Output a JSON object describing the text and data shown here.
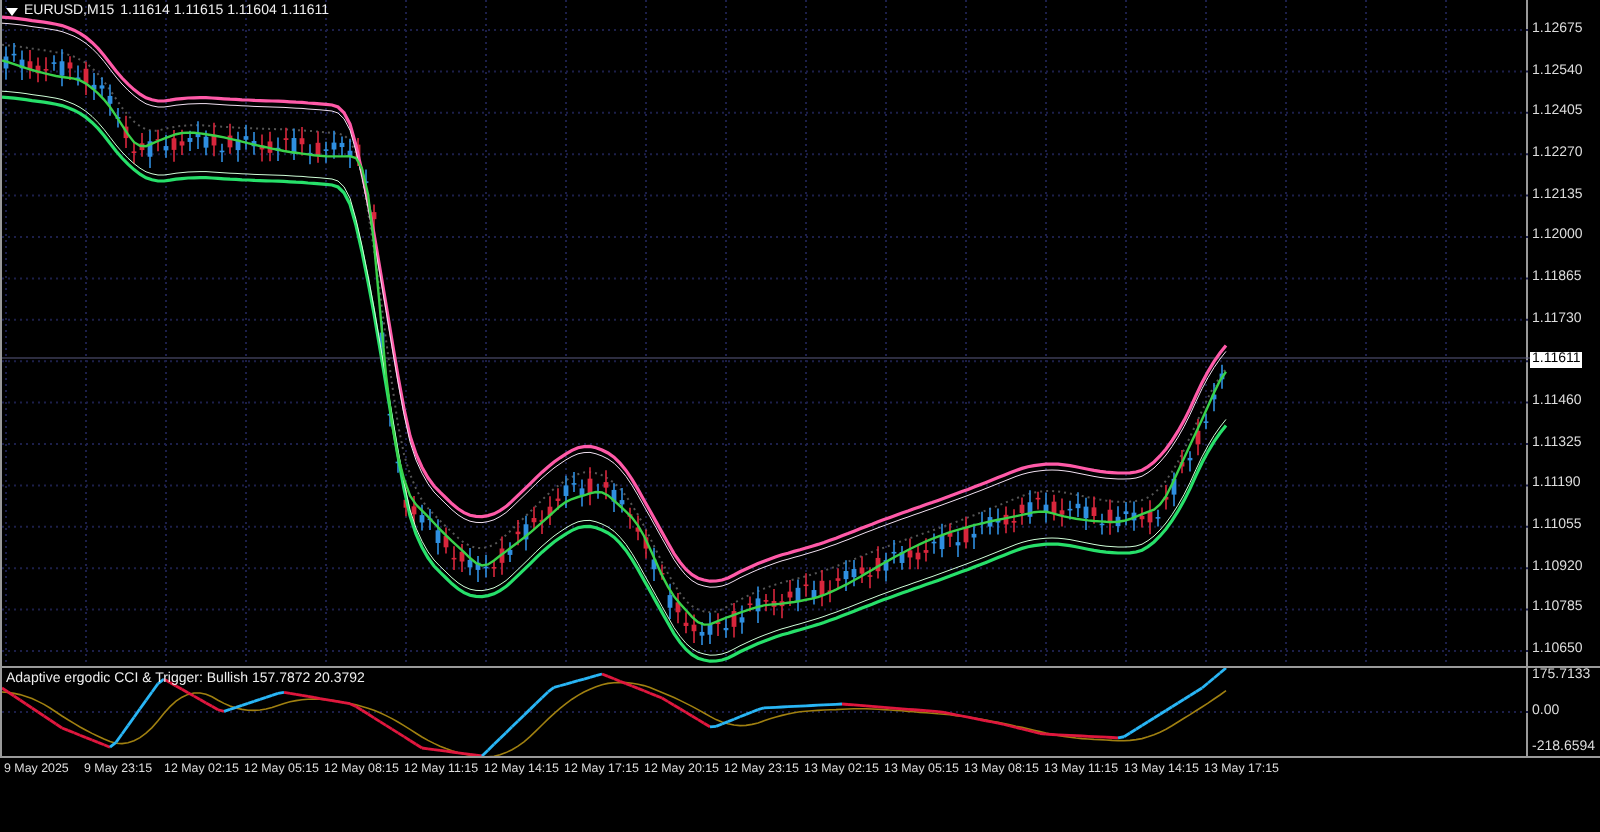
{
  "chart": {
    "symbol": "EURUSD,M15",
    "quotes": "1.11614 1.11615 1.11604 1.11611"
  },
  "price_axis": [
    "1.12675",
    "1.12540",
    "1.12405",
    "1.12270",
    "1.12135",
    "1.12000",
    "1.11865",
    "1.11730",
    "1.11460",
    "1.11325",
    "1.11190",
    "1.11055",
    "1.10920",
    "1.10785",
    "1.10650"
  ],
  "current_price": "1.11611",
  "indicator": {
    "label": "Adaptive ergodic CCI & Trigger: Bullish 157.7872 20.3792",
    "axis": [
      "175.7133",
      "0.00",
      "-218.6594"
    ]
  },
  "time_axis": [
    "9 May 2025",
    "9 May 23:15",
    "12 May 02:15",
    "12 May 05:15",
    "12 May 08:15",
    "12 May 11:15",
    "12 May 14:15",
    "12 May 17:15",
    "12 May 20:15",
    "12 May 23:15",
    "13 May 02:15",
    "13 May 05:15",
    "13 May 08:15",
    "13 May 11:15",
    "13 May 14:15",
    "13 May 17:15"
  ]
}
